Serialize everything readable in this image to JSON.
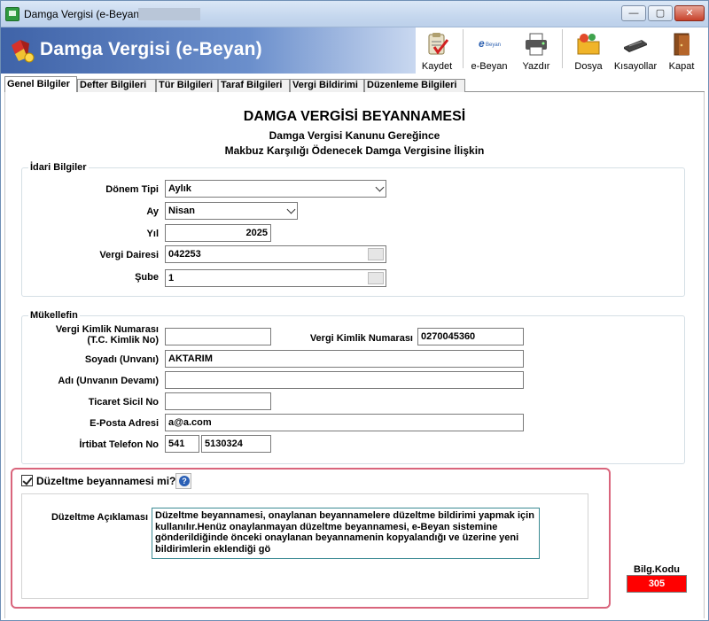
{
  "window": {
    "title": "Damga Vergisi (e-Beyan)",
    "min_glyph": "—",
    "max_glyph": "▢",
    "close_glyph": "✕"
  },
  "header": {
    "title": "Damga Vergisi (e-Beyan)"
  },
  "toolbar": {
    "kaydet": "Kaydet",
    "ebeyan": "e-Beyan",
    "ebeyan_icon_text": "Beyan",
    "yazdir": "Yazdır",
    "dosya": "Dosya",
    "kisayollar": "Kısayollar",
    "kapat": "Kapat"
  },
  "tabs": [
    {
      "label": "Genel Bilgiler"
    },
    {
      "label": "Defter Bilgileri"
    },
    {
      "label": "Tür Bilgileri"
    },
    {
      "label": "Taraf Bilgileri"
    },
    {
      "label": "Vergi Bildirimi"
    },
    {
      "label": "Düzenleme Bilgileri"
    }
  ],
  "form": {
    "title": "DAMGA VERGİSİ BEYANNAMESİ",
    "subtitle1": "Damga Vergisi Kanunu Gereğince",
    "subtitle2": "Makbuz Karşılığı Ödenecek Damga Vergisine İlişkin"
  },
  "idari": {
    "legend": "İdari Bilgiler",
    "donem_label": "Dönem Tipi",
    "donem_value": "Aylık",
    "ay_label": "Ay",
    "ay_value": "Nisan",
    "yil_label": "Yıl",
    "yil_value": "2025",
    "vd_label": "Vergi Dairesi",
    "vd_value": "042253",
    "sube_label": "Şube",
    "sube_value": "1"
  },
  "mukellef": {
    "legend": "Mükellefin",
    "tckn_label1": "Vergi Kimlik Numarası",
    "tckn_label2": "(T.C. Kimlik No)",
    "tckn_value": "",
    "vkn_label": "Vergi Kimlik Numarası",
    "vkn_value": "0270045360",
    "soyadi_label": "Soyadı (Unvanı)",
    "soyadi_value": "AKTARIM",
    "adi_label": "Adı (Unvanın Devamı)",
    "adi_value": "",
    "sicil_label": "Ticaret Sicil No",
    "sicil_value": "",
    "eposta_label": "E-Posta Adresi",
    "eposta_value": "a@a.com",
    "tel_label": "İrtibat Telefon No",
    "tel_code": "541",
    "tel_number": "5130324"
  },
  "duzeltme": {
    "checkbox_label": "Düzeltme beyannamesi mi?",
    "checked": true,
    "aciklama_label": "Düzeltme Açıklaması",
    "aciklama_text": "Düzeltme beyannamesi, onaylanan beyannamelere düzeltme bildirimi yapmak için kullanılır.Henüz onaylanmayan düzeltme beyannamesi, e-Beyan sistemine gönderildiğinde önceki onaylanan beyannamenin kopyalandığı ve üzerine yeni bildirimlerin eklendiği gö"
  },
  "bilg": {
    "label": "Bilg.Kodu",
    "value": "305",
    "color": "#ff0000"
  }
}
